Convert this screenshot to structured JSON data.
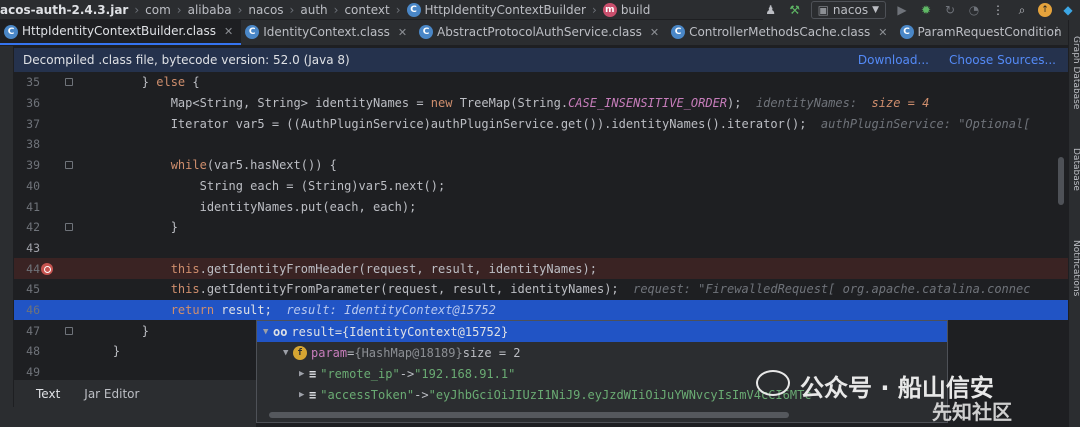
{
  "breadcrumb": {
    "jar": "acos-auth-2.4.3.jar",
    "path": [
      "com",
      "alibaba",
      "nacos",
      "auth",
      "context"
    ],
    "class": "HttpIdentityContextBuilder",
    "method": "build"
  },
  "toolbar": {
    "run_config": "nacos"
  },
  "tabs": [
    {
      "label": "HttpIdentityContextBuilder.class",
      "active": true
    },
    {
      "label": "IdentityContext.class",
      "active": false
    },
    {
      "label": "AbstractProtocolAuthService.class",
      "active": false
    },
    {
      "label": "ControllerMethodsCache.class",
      "active": false
    },
    {
      "label": "ParamRequestCondition",
      "active": false
    }
  ],
  "banner": {
    "message": "Decompiled .class file, bytecode version: 52.0 (Java 8)",
    "download_link": "Download...",
    "choose_sources_link": "Choose Sources..."
  },
  "code_lines": [
    {
      "no": "35",
      "indent": "        ",
      "segs": [
        [
          "",
          "} "
        ],
        [
          "kw",
          "else"
        ],
        [
          "",
          " {"
        ]
      ]
    },
    {
      "no": "36",
      "indent": "            ",
      "segs": [
        [
          "",
          "Map<String, String> identityNames = "
        ],
        [
          "kw",
          "new"
        ],
        [
          "",
          " TreeMap(String."
        ],
        [
          "stat",
          "CASE_INSENSITIVE_ORDER"
        ],
        [
          "",
          ");  "
        ],
        [
          "hint",
          "identityNames:  "
        ],
        [
          "hint-num",
          "size = 4"
        ]
      ]
    },
    {
      "no": "37",
      "indent": "            ",
      "segs": [
        [
          "",
          "Iterator var5 = ((AuthPluginService)authPluginService.get()).identityNames().iterator();  "
        ],
        [
          "hint",
          "authPluginService: \"Optional["
        ]
      ]
    },
    {
      "no": "38",
      "indent": "",
      "segs": []
    },
    {
      "no": "39",
      "indent": "            ",
      "segs": [
        [
          "kw",
          "while"
        ],
        [
          "",
          "(var5.hasNext()) {"
        ]
      ]
    },
    {
      "no": "40",
      "indent": "                ",
      "segs": [
        [
          "",
          "String each = (String)var5.next();"
        ]
      ]
    },
    {
      "no": "41",
      "indent": "                ",
      "segs": [
        [
          "",
          "identityNames.put(each, each);"
        ]
      ]
    },
    {
      "no": "42",
      "indent": "            ",
      "segs": [
        [
          "",
          "}"
        ]
      ]
    },
    {
      "no": "43",
      "indent": "",
      "segs": []
    },
    {
      "no": "44",
      "indent": "            ",
      "segs": [
        [
          "kw",
          "this"
        ],
        [
          "",
          ".getIdentityFromHeader(request, result, identityNames);"
        ]
      ]
    },
    {
      "no": "45",
      "indent": "            ",
      "segs": [
        [
          "kw",
          "this"
        ],
        [
          "",
          ".getIdentityFromParameter(request, result, identityNames);  "
        ],
        [
          "hint",
          "request: \"FirewalledRequest[ org.apache.catalina.connec"
        ]
      ]
    },
    {
      "no": "46",
      "indent": "            ",
      "segs": [
        [
          "kw",
          "return"
        ],
        [
          "",
          " result;  "
        ],
        [
          "hint",
          "result: IdentityContext@15752"
        ]
      ]
    },
    {
      "no": "47",
      "indent": "        ",
      "segs": [
        [
          "",
          "}"
        ]
      ]
    },
    {
      "no": "48",
      "indent": "    ",
      "segs": [
        [
          "",
          "}"
        ]
      ]
    },
    {
      "no": "49",
      "indent": "",
      "segs": []
    }
  ],
  "debug_popup": {
    "root": {
      "name": "result",
      "eq": " = ",
      "value": "{IdentityContext@15752}"
    },
    "param": {
      "name": "param",
      "eq": " = ",
      "type": "{HashMap@18189}",
      "size": " size = 2"
    },
    "entries": [
      {
        "key": "\"remote_ip\"",
        "arrow": " -> ",
        "value": "\"192.168.91.1\""
      },
      {
        "key": "\"accessToken\"",
        "arrow": " -> ",
        "value": "\"eyJhbGciOiJIUzI1NiJ9.eyJzdWIiOiJuYWNvcyIsImV4cCI6MTc"
      }
    ]
  },
  "bottom_tabs": [
    {
      "label": "Text",
      "active": true
    },
    {
      "label": "Jar Editor",
      "active": false
    }
  ],
  "right_strip": [
    "Graph Database",
    "Database",
    "Notifications"
  ],
  "watermark": {
    "brand1": "公众号 · 船山信安",
    "brand2": "先知社区"
  }
}
